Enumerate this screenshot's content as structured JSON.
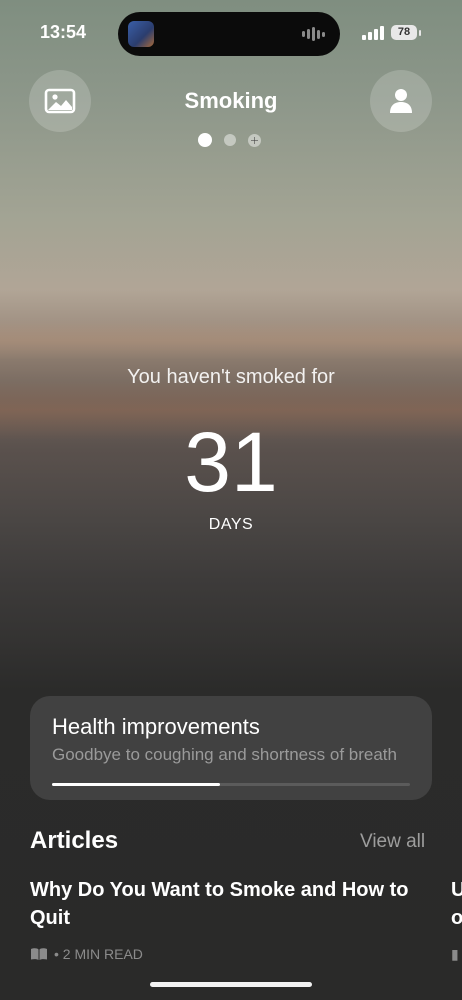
{
  "status_bar": {
    "time": "13:54",
    "battery": "78"
  },
  "header": {
    "title": "Smoking",
    "left_icon": "image-icon",
    "right_icon": "person-icon",
    "page_dots": 3,
    "active_dot": 0
  },
  "counter": {
    "subtitle": "You haven't smoked for",
    "value": "31",
    "unit": "DAYS"
  },
  "health_card": {
    "title": "Health improvements",
    "subtitle": "Goodbye to coughing and shortness of breath",
    "progress": 0.47
  },
  "articles": {
    "title": "Articles",
    "view_all": "View all",
    "items": [
      {
        "title": "Why Do You Want to Smoke and How to Quit",
        "meta": "• 2 MIN READ"
      },
      {
        "title": "U o",
        "meta": "▮"
      }
    ]
  },
  "colors": {
    "card_bg": "#414141",
    "page_bg": "#2a2a29",
    "accent": "#ffffff"
  }
}
